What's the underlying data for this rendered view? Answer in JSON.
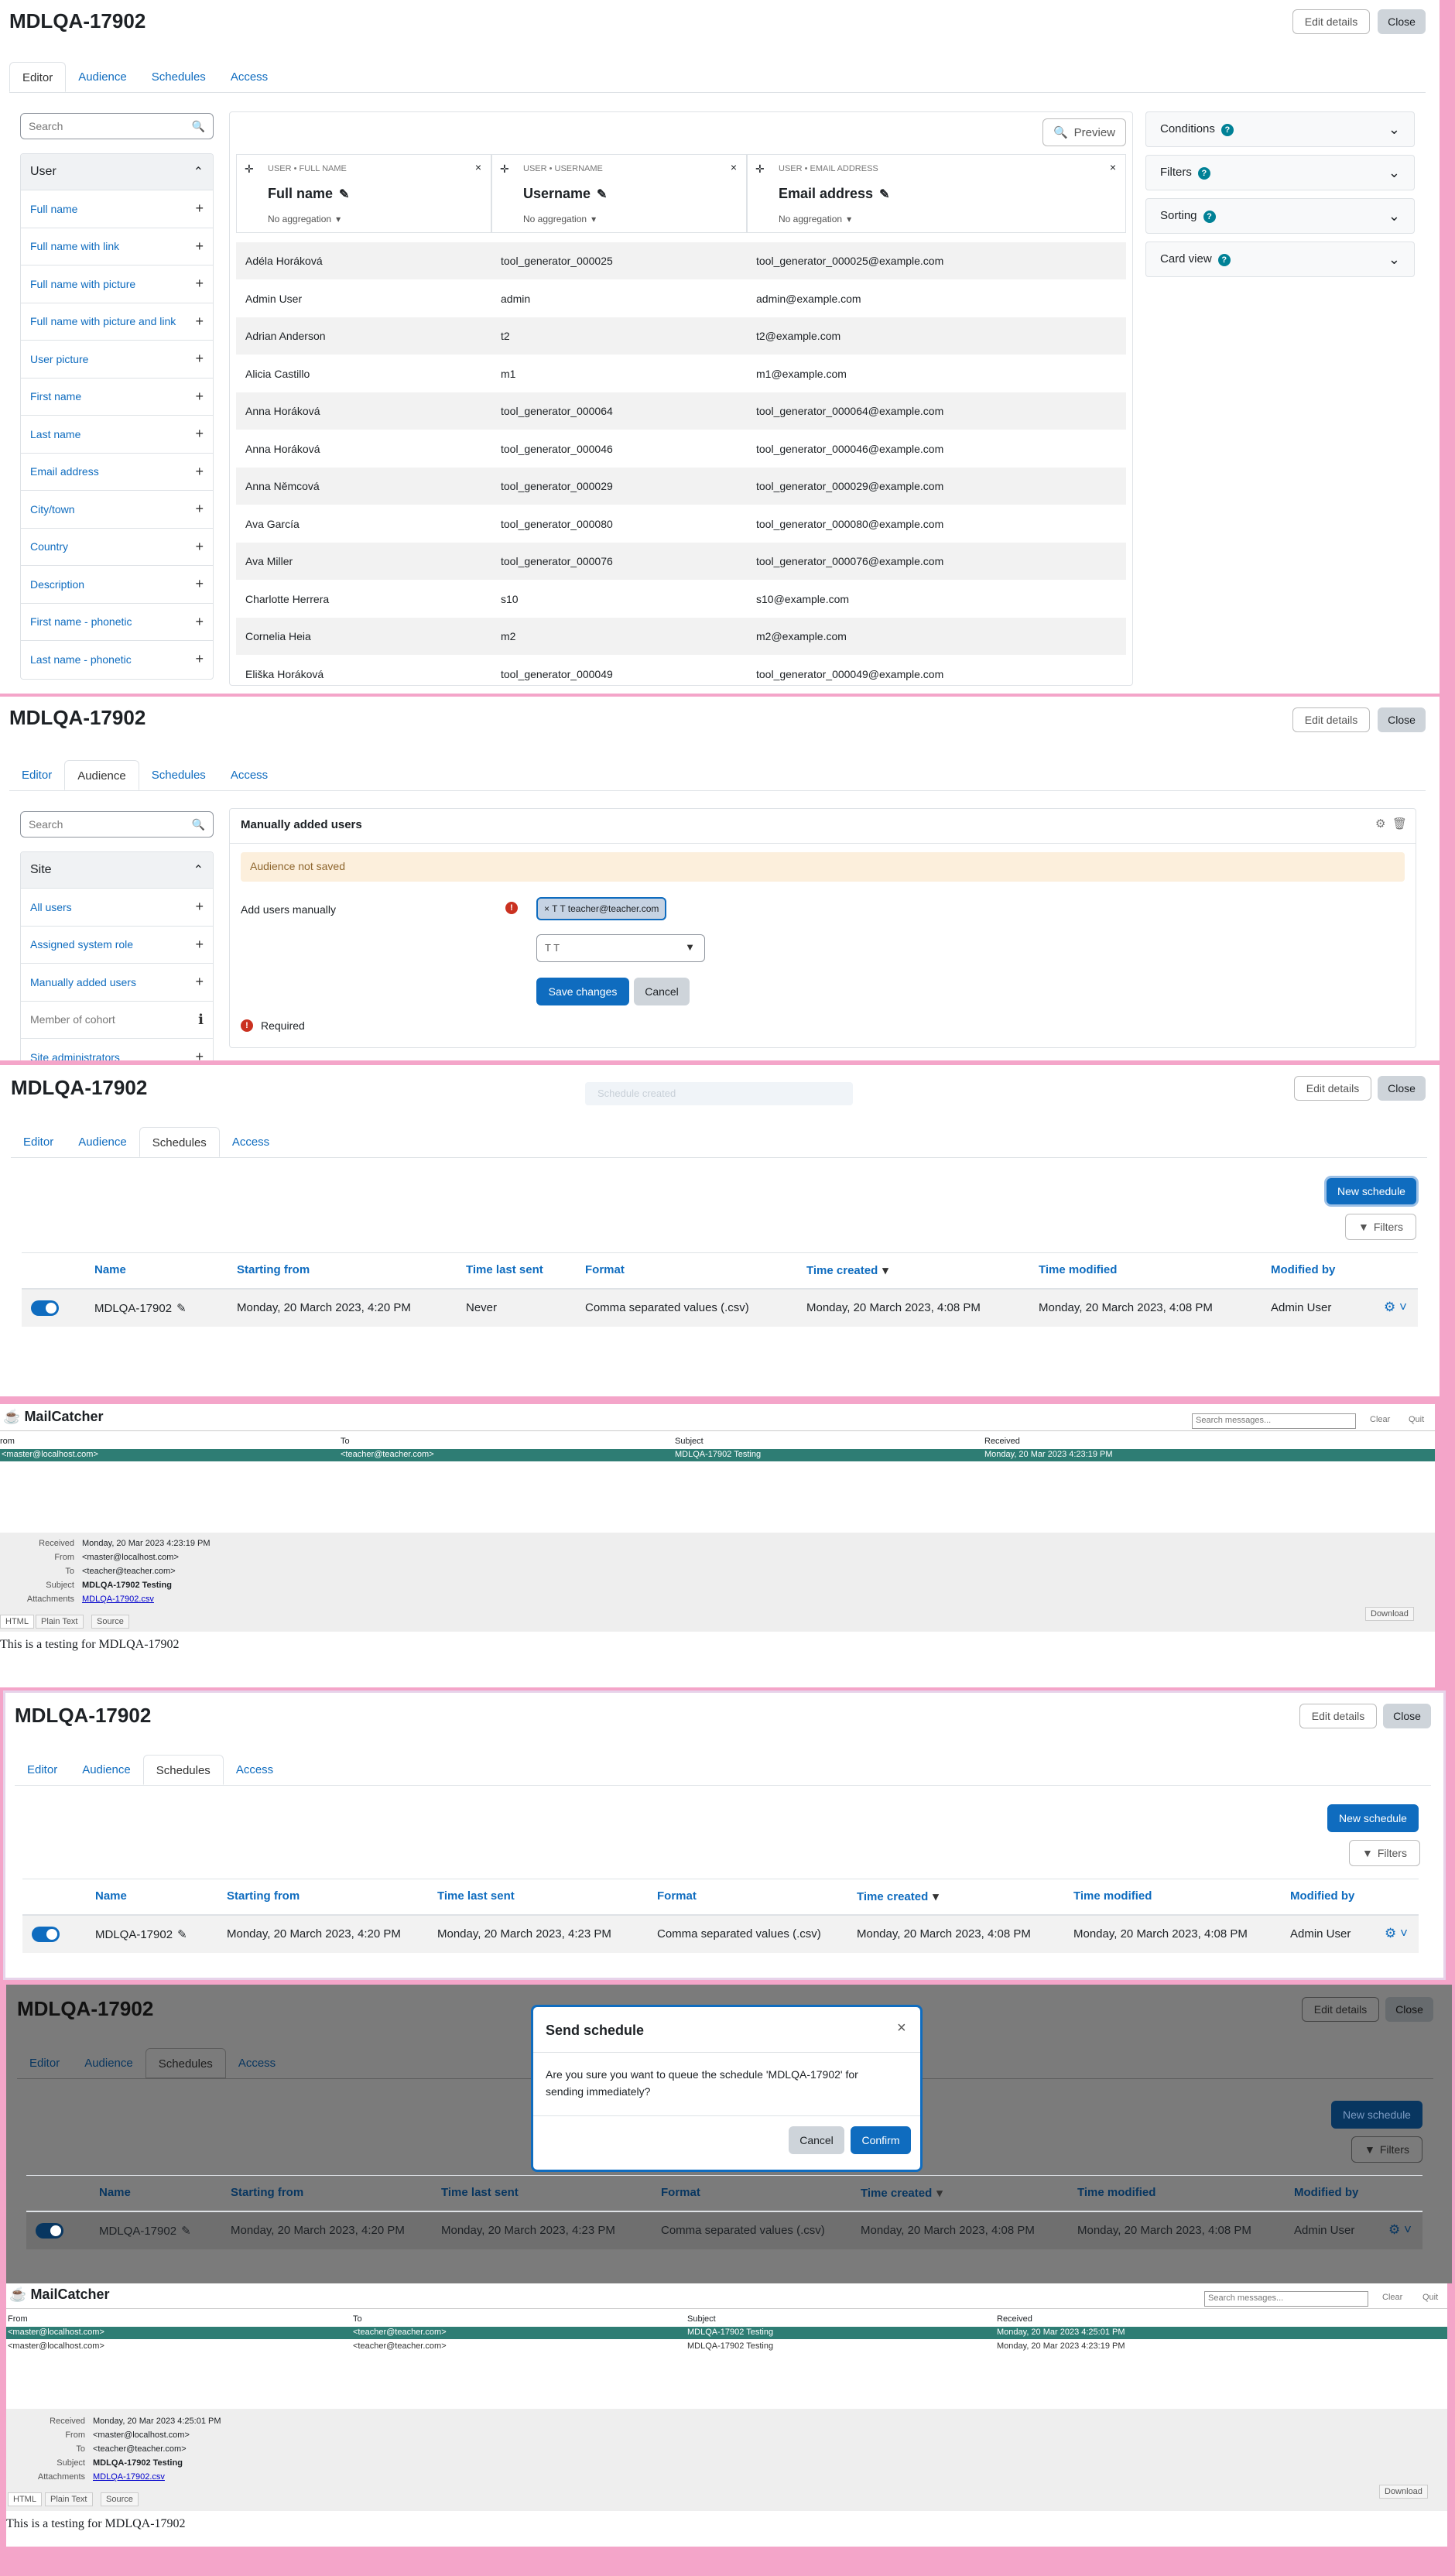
{
  "report": {
    "title": "MDLQA-17902",
    "edit_label": "Edit details",
    "close_label": "Close"
  },
  "tabs": [
    "Editor",
    "Audience",
    "Schedules",
    "Access"
  ],
  "search_placeholder": "Search",
  "editor": {
    "sidebar_title": "User",
    "sidebar_items": [
      "Full name",
      "Full name with link",
      "Full name with picture",
      "Full name with picture and link",
      "User picture",
      "First name",
      "Last name",
      "Email address",
      "City/town",
      "Country",
      "Description",
      "First name - phonetic",
      "Last name - phonetic"
    ],
    "preview_label": "Preview",
    "columns": [
      {
        "label": "USER • FULL NAME",
        "name": "Full name",
        "agg": "No aggregation"
      },
      {
        "label": "USER • USERNAME",
        "name": "Username",
        "agg": "No aggregation"
      },
      {
        "label": "USER • EMAIL ADDRESS",
        "name": "Email address",
        "agg": "No aggregation"
      }
    ],
    "rows": [
      [
        "Adéla Horáková",
        "tool_generator_000025",
        "tool_generator_000025@example.com"
      ],
      [
        "Admin User",
        "admin",
        "admin@example.com"
      ],
      [
        "Adrian Anderson",
        "t2",
        "t2@example.com"
      ],
      [
        "Alicia Castillo",
        "m1",
        "m1@example.com"
      ],
      [
        "Anna Horáková",
        "tool_generator_000064",
        "tool_generator_000064@example.com"
      ],
      [
        "Anna Horáková",
        "tool_generator_000046",
        "tool_generator_000046@example.com"
      ],
      [
        "Anna Němcová",
        "tool_generator_000029",
        "tool_generator_000029@example.com"
      ],
      [
        "Ava García",
        "tool_generator_000080",
        "tool_generator_000080@example.com"
      ],
      [
        "Ava Miller",
        "tool_generator_000076",
        "tool_generator_000076@example.com"
      ],
      [
        "Charlotte Herrera",
        "s10",
        "s10@example.com"
      ],
      [
        "Cornelia Heia",
        "m2",
        "m2@example.com"
      ],
      [
        "Eliška Horáková",
        "tool_generator_000049",
        "tool_generator_000049@example.com"
      ]
    ],
    "cards": [
      "Conditions",
      "Filters",
      "Sorting",
      "Card view"
    ]
  },
  "audience": {
    "sidebar_title": "Site",
    "sidebar_items": [
      "All users",
      "Assigned system role",
      "Manually added users",
      "Member of cohort",
      "Site administrators"
    ],
    "card_title": "Manually added users",
    "warning": "Audience not saved",
    "field_label": "Add users manually",
    "chip": "× T T teacher@teacher.com",
    "select_value": "T T",
    "save_label": "Save changes",
    "cancel_label": "Cancel",
    "required_label": "Required",
    "toast": "Schedule created"
  },
  "schedules": {
    "new_label": "New schedule",
    "filters_label": "Filters",
    "headers": [
      "Name",
      "Starting from",
      "Time last sent",
      "Format",
      "Time created",
      "Time modified",
      "Modified by"
    ],
    "row_before": [
      "MDLQA-17902",
      "Monday, 20 March 2023, 4:20 PM",
      "Never",
      "Comma separated values (.csv)",
      "Monday, 20 March 2023, 4:08 PM",
      "Monday, 20 March 2023, 4:08 PM",
      "Admin User"
    ],
    "row_after": [
      "MDLQA-17902",
      "Monday, 20 March 2023, 4:20 PM",
      "Monday, 20 March 2023, 4:23 PM",
      "Comma separated values (.csv)",
      "Monday, 20 March 2023, 4:08 PM",
      "Monday, 20 March 2023, 4:08 PM",
      "Admin User"
    ]
  },
  "modal": {
    "title": "Send schedule",
    "body": "Are you sure you want to queue the schedule 'MDLQA-17902' for sending immediately?",
    "cancel": "Cancel",
    "confirm": "Confirm"
  },
  "mailcatcher": {
    "app": "MailCatcher",
    "search_placeholder": "Search messages...",
    "clear": "Clear",
    "quit": "Quit",
    "col_from": "From",
    "col_from_cut": "rom",
    "col_to": "To",
    "col_subject": "Subject",
    "col_received": "Received",
    "msg1": {
      "from": "<master@localhost.com>",
      "to": "<teacher@teacher.com>",
      "subject": "MDLQA-17902 Testing",
      "received": "Monday, 20 Mar 2023 4:23:19 PM"
    },
    "msg2": {
      "from": "<master@localhost.com>",
      "to": "<teacher@teacher.com>",
      "subject": "MDLQA-17902 Testing",
      "received": "Monday, 20 Mar 2023 4:25:01 PM"
    },
    "meta_keys": [
      "Received",
      "From",
      "To",
      "Subject",
      "Attachments"
    ],
    "meta1": {
      "received": "Monday, 20 Mar 2023 4:23:19 PM",
      "from": "<master@localhost.com>",
      "to": "<teacher@teacher.com>",
      "subject": "MDLQA-17902 Testing",
      "attachment": "MDLQA-17902.csv"
    },
    "meta2": {
      "received": "Monday, 20 Mar 2023 4:25:01 PM",
      "from": "<master@localhost.com>",
      "to": "<teacher@teacher.com>",
      "subject": "MDLQA-17902 Testing",
      "attachment": "MDLQA-17902.csv"
    },
    "view_tabs": [
      "HTML",
      "Plain Text",
      "Source"
    ],
    "download": "Download",
    "body": "This is a testing for MDLQA-17902"
  }
}
